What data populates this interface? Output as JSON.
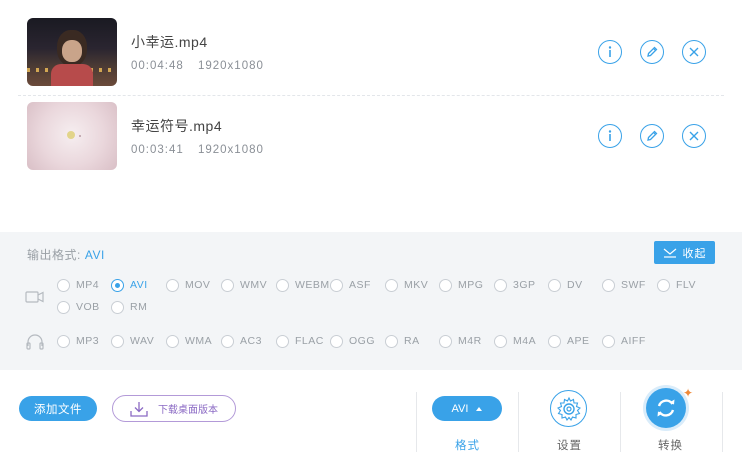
{
  "files": [
    {
      "name": "小幸运.mp4",
      "duration": "00:04:48",
      "resolution": "1920x1080"
    },
    {
      "name": "幸运符号.mp4",
      "duration": "00:03:41",
      "resolution": "1920x1080"
    }
  ],
  "file_actions": {
    "info": "info-icon",
    "edit": "edit-icon",
    "remove": "close-icon"
  },
  "output": {
    "label": "输出格式:",
    "value": "AVI",
    "collapse_label": "收起"
  },
  "video_formats": [
    "MP4",
    "AVI",
    "MOV",
    "WMV",
    "WEBM",
    "ASF",
    "MKV",
    "MPG",
    "3GP",
    "DV",
    "SWF",
    "FLV",
    "VOB",
    "RM"
  ],
  "audio_formats": [
    "MP3",
    "WAV",
    "WMA",
    "AC3",
    "FLAC",
    "OGG",
    "RA",
    "M4R",
    "M4A",
    "APE",
    "AIFF"
  ],
  "selected_format": "AVI",
  "bottom": {
    "add_file": "添加文件",
    "download_desktop": "下载桌面版本",
    "format_pill": "AVI",
    "format_label": "格式",
    "settings_label": "设置",
    "convert_label": "转换"
  },
  "colors": {
    "accent": "#39a2e8",
    "purple": "#8b6ac4",
    "spark": "#f08a3a",
    "panel_bg": "#f3f5f7"
  }
}
